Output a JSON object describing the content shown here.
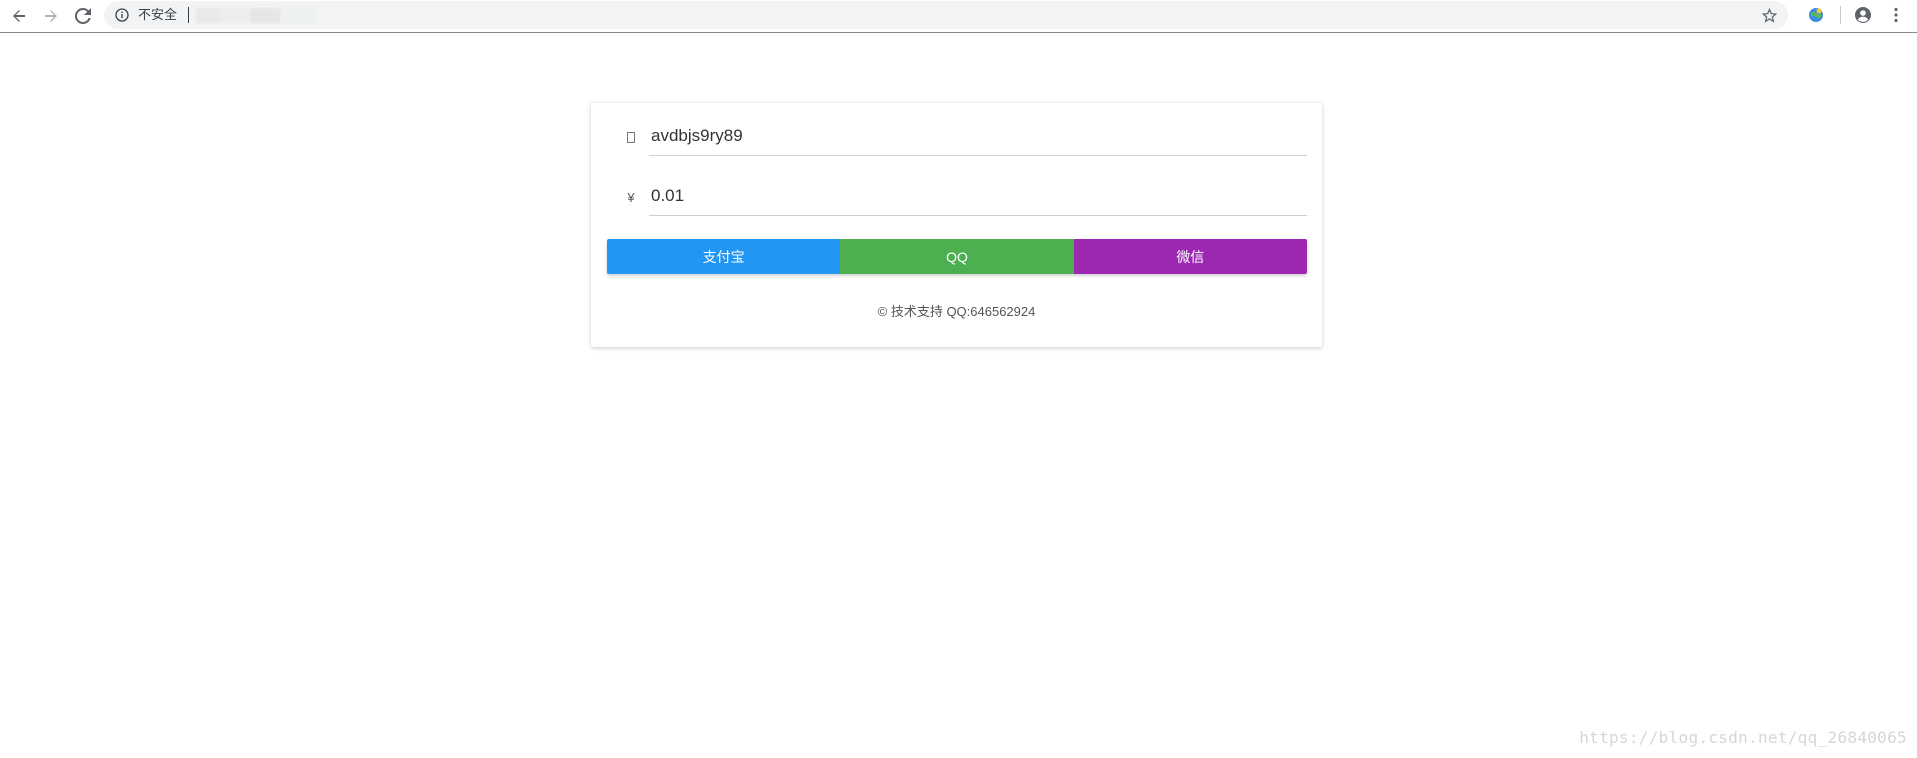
{
  "browser": {
    "security_label": "不安全",
    "icons": {
      "back": "arrow-left-icon",
      "forward": "arrow-right-icon",
      "reload": "reload-icon",
      "info": "info-icon",
      "bookmark": "star-icon",
      "extension": "extension-icon",
      "profile": "account-circle-icon",
      "menu": "kebab-menu-icon"
    }
  },
  "form": {
    "order_icon": "order-icon",
    "order_id": "avdbjs9ry89",
    "amount_icon": "¥",
    "amount": "0.01"
  },
  "payment_buttons": [
    {
      "label": "支付宝",
      "color": "#2196f3"
    },
    {
      "label": "QQ",
      "color": "#4caf50"
    },
    {
      "label": "微信",
      "color": "#9c27b0"
    }
  ],
  "footer": {
    "text": "© 技术支持 QQ:646562924"
  },
  "watermark": {
    "text": "https://blog.csdn.net/qq_26840065"
  }
}
